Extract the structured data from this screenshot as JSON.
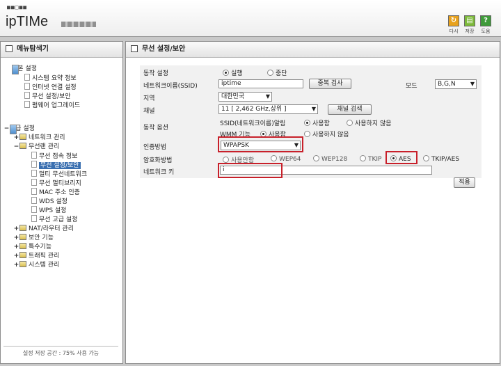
{
  "header": {
    "logo_dots": "■■□■■",
    "logo_text": "ipTIMe",
    "buttons": [
      {
        "label": "다시",
        "icon": "refresh-icon",
        "color": "#e8a21e"
      },
      {
        "label": "저장",
        "icon": "save-icon",
        "color": "#7cb93a"
      },
      {
        "label": "도움",
        "icon": "help-icon",
        "color": "#3f9b3a",
        "glyph": "?"
      }
    ]
  },
  "sidebar": {
    "title": "메뉴탐색기",
    "groups": [
      {
        "label": "기본 설정",
        "toggle": "",
        "items": [
          "시스템 요약 정보",
          "인터넷 연결 설정",
          "무선 설정/보안",
          "펌웨어 업그레이드"
        ]
      },
      {
        "label": "고급 설정",
        "toggle": "−",
        "children": [
          {
            "label": "네트워크 관리",
            "toggle": "+"
          },
          {
            "label": "무선랜 관리",
            "toggle": "−",
            "items": [
              "무선 접속 정보",
              "무선 설정/보안",
              "멀티 무선네트워크",
              "무선 멀티브리지",
              "MAC 주소 인증",
              "WDS 설정",
              "WPS 설정",
              "무선 고급 설정"
            ]
          },
          {
            "label": "NAT/라우터 관리",
            "toggle": "+"
          },
          {
            "label": "보안 기능",
            "toggle": "+"
          },
          {
            "label": "특수기능",
            "toggle": "+"
          },
          {
            "label": "트래픽 관리",
            "toggle": "+"
          },
          {
            "label": "시스템 관리",
            "toggle": "+"
          }
        ]
      }
    ],
    "footer": "설정 저장 공간 : 75% 사용 가능"
  },
  "main": {
    "title": "무선 설정/보안",
    "form": {
      "operation_label": "동작 설정",
      "operation_options": [
        "실행",
        "중단"
      ],
      "operation_selected": "실행",
      "ssid_label": "네트워크이름(SSID)",
      "ssid_value": "iptime",
      "dup_check_button": "중복 검사",
      "mode_label": "모드",
      "mode_value": "B,G,N",
      "region_label": "지역",
      "region_value": "대한민국",
      "channel_label": "채널",
      "channel_value": "11 [ 2,462 GHz,상위 ]",
      "channel_search_button": "채널 검색",
      "options_label": "동작 옵션",
      "ssid_broadcast_label": "SSID(네트워크이름)알림",
      "ssid_broadcast_options": [
        "사용함",
        "사용하지 않음"
      ],
      "ssid_broadcast_selected": "사용함",
      "wmm_label": "WMM 기능",
      "wmm_options": [
        "사용함",
        "사용하지 않음"
      ],
      "wmm_selected": "사용함",
      "auth_label": "인증방법",
      "auth_value": "WPAPSK",
      "enc_label": "암호화방법",
      "enc_options": [
        "사용안함",
        "WEP64",
        "WEP128",
        "TKIP",
        "AES",
        "TKIP/AES"
      ],
      "enc_selected": "AES",
      "key_label": "네트워크 키",
      "key_value": "i",
      "apply_button": "적용"
    }
  },
  "colors": {
    "highlight": "#c8202a",
    "selection": "#3a6fb0"
  }
}
